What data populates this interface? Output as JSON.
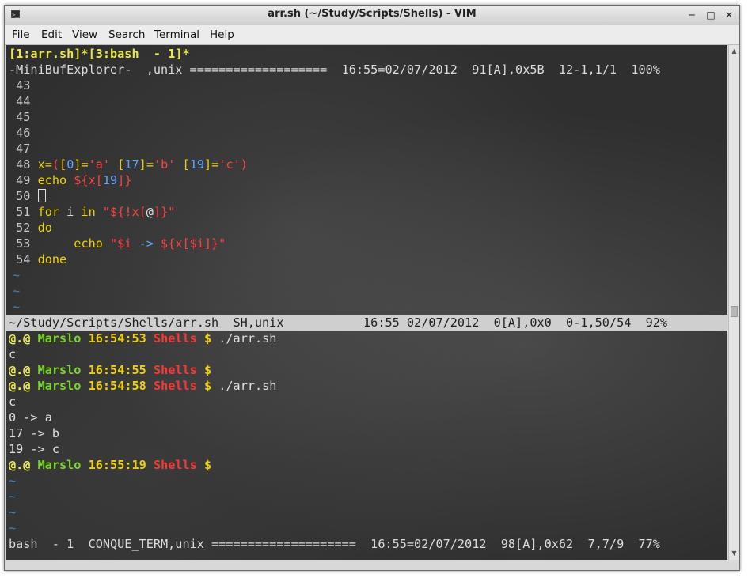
{
  "window": {
    "title": "arr.sh (~/Study/Scripts/Shells) - VIM",
    "minimize_glyph": "─",
    "maximize_glyph": "□",
    "close_glyph": "✕",
    "app_icon": "terminal-icon"
  },
  "menu": [
    "File",
    "Edit",
    "View",
    "Search",
    "Terminal",
    "Help"
  ],
  "vim": {
    "tab_line": "[1:arr.sh]*[3:bash  - 1]*",
    "minibuf_status": "-MiniBufExplorer-  ,unix ===================  16:55=02/07/2012  91[A],0x5B  12-1,1/1  100%",
    "code": {
      "l43": " 43",
      "l44": " 44",
      "l45": " 45",
      "l46": " 46",
      "l47": " 47",
      "l48_num": " 48 ",
      "l48_kw": "x=",
      "l48_p1": "(",
      "l48_p2": "[",
      "l48_n0": "0",
      "l48_p3": "]=",
      "l48_s1": "'a'",
      "l48_p4": " [",
      "l48_n17": "17",
      "l48_p5": "]=",
      "l48_s2": "'b'",
      "l48_p6": " [",
      "l48_n19": "19",
      "l48_p7": "]=",
      "l48_s3": "'c'",
      "l48_p8": ")",
      "l49_num": " 49 ",
      "l49_kw": "echo ",
      "l49_s1": "${x[",
      "l49_n": "19",
      "l49_s2": "]}",
      "l50_num": " 50 ",
      "l51_num": " 51 ",
      "l51_kw1": "for",
      "l51_t1": " i ",
      "l51_kw2": "in",
      "l51_t2": " ",
      "l51_s1": "\"${!x[",
      "l51_at": "@",
      "l51_s2": "]}\"",
      "l52_num": " 52 ",
      "l52_kw": "do",
      "l53_num": " 53 ",
      "l53_indent": "     ",
      "l53_kw": "echo ",
      "l53_s1": "\"$i ",
      "l53_arrow": "->",
      "l53_s2": " ${x[$i]}\"",
      "l54_num": " 54 ",
      "l54_kw": "done"
    },
    "tilde": "~",
    "file_status": "~/Study/Scripts/Shells/arr.sh  SH,unix           16:55 02/07/2012  0[A],0x0  0-1,50/54  92%",
    "conque_status": "bash  - 1  CONQUE_TERM,unix ====================  16:55=02/07/2012  98[A],0x62  7,7/9  77%"
  },
  "terminal": {
    "prompt_at": "@.@",
    "user": "Marslo",
    "dir": "Shells",
    "sym": "$",
    "p1_time": "16:54:53",
    "p1_cmd": " ./arr.sh",
    "out1": "c",
    "p2_time": "16:54:55",
    "p3_time": "16:54:58",
    "p3_cmd": " ./arr.sh",
    "out2": "c",
    "out3": "0 -> a",
    "out4": "17 -> b",
    "out5": "19 -> c",
    "p4_time": "16:55:19"
  },
  "colors": {
    "terminal_bg": "#2f2f2f",
    "keyword": "#f0d000",
    "string": "#ff4040",
    "number": "#5fa5ff",
    "tilde": "#3d84c0",
    "user": "#7bd62a"
  }
}
